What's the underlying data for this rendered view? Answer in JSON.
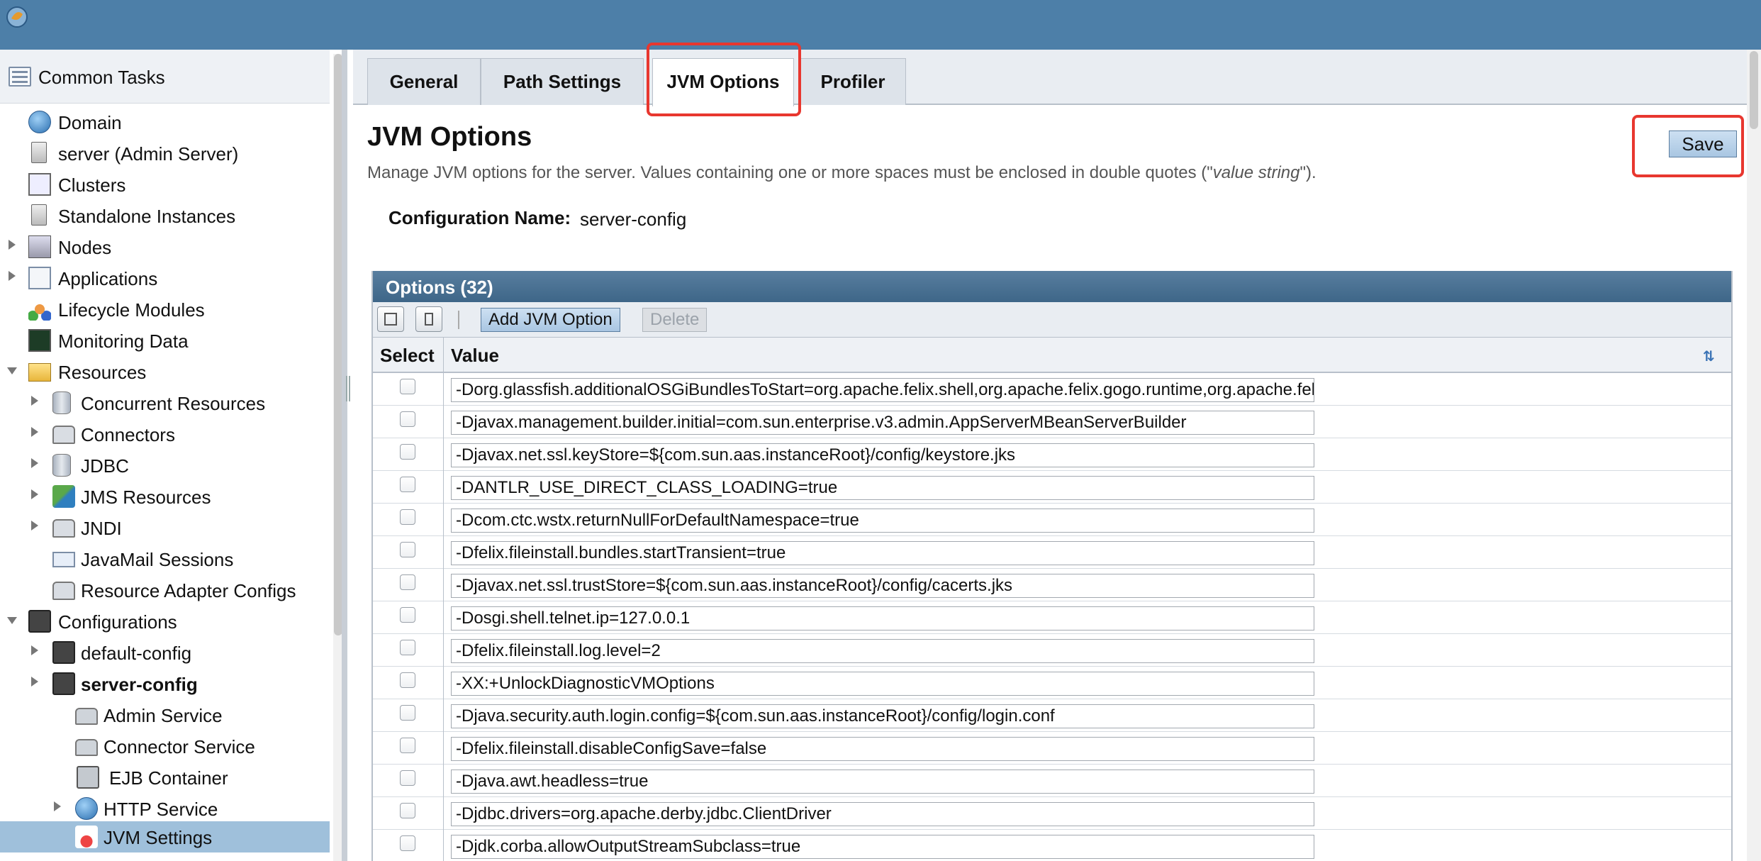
{
  "sidebar": {
    "header": "Common Tasks",
    "items": [
      {
        "label": "Domain"
      },
      {
        "label": "server (Admin Server)"
      },
      {
        "label": "Clusters"
      },
      {
        "label": "Standalone Instances"
      },
      {
        "label": "Nodes"
      },
      {
        "label": "Applications"
      },
      {
        "label": "Lifecycle Modules"
      },
      {
        "label": "Monitoring Data"
      },
      {
        "label": "Resources"
      },
      {
        "label": "Concurrent Resources"
      },
      {
        "label": "Connectors"
      },
      {
        "label": "JDBC"
      },
      {
        "label": "JMS Resources"
      },
      {
        "label": "JNDI"
      },
      {
        "label": "JavaMail Sessions"
      },
      {
        "label": "Resource Adapter Configs"
      },
      {
        "label": "Configurations"
      },
      {
        "label": "default-config"
      },
      {
        "label": "server-config"
      },
      {
        "label": "Admin Service"
      },
      {
        "label": "Connector Service"
      },
      {
        "label": "EJB Container"
      },
      {
        "label": "HTTP Service"
      },
      {
        "label": "JVM Settings"
      }
    ]
  },
  "tabs": [
    {
      "label": "General"
    },
    {
      "label": "Path Settings"
    },
    {
      "label": "JVM Options"
    },
    {
      "label": "Profiler"
    }
  ],
  "page": {
    "title": "JVM Options",
    "desc_prefix": "Manage JVM options for the server. Values containing one or more spaces must be enclosed in double quotes (\"",
    "desc_italic": "value string",
    "desc_suffix": "\").",
    "save_label": "Save",
    "config_name_label": "Configuration Name:",
    "config_name_value": "server-config"
  },
  "table": {
    "title": "Options (32)",
    "add_label": "Add JVM Option",
    "delete_label": "Delete",
    "col_select": "Select",
    "col_value": "Value",
    "rows": [
      "-Dorg.glassfish.additionalOSGiBundlesToStart=org.apache.felix.shell,org.apache.felix.gogo.runtime,org.apache.felix.gogo.shell",
      "-Djavax.management.builder.initial=com.sun.enterprise.v3.admin.AppServerMBeanServerBuilder",
      "-Djavax.net.ssl.keyStore=${com.sun.aas.instanceRoot}/config/keystore.jks",
      "-DANTLR_USE_DIRECT_CLASS_LOADING=true",
      "-Dcom.ctc.wstx.returnNullForDefaultNamespace=true",
      "-Dfelix.fileinstall.bundles.startTransient=true",
      "-Djavax.net.ssl.trustStore=${com.sun.aas.instanceRoot}/config/cacerts.jks",
      "-Dosgi.shell.telnet.ip=127.0.0.1",
      "-Dfelix.fileinstall.log.level=2",
      "-XX:+UnlockDiagnosticVMOptions",
      "-Djava.security.auth.login.config=${com.sun.aas.instanceRoot}/config/login.conf",
      "-Dfelix.fileinstall.disableConfigSave=false",
      "-Djava.awt.headless=true",
      "-Djdbc.drivers=org.apache.derby.jdbc.ClientDriver",
      "-Djdk.corba.allowOutputStreamSubclass=true"
    ]
  }
}
